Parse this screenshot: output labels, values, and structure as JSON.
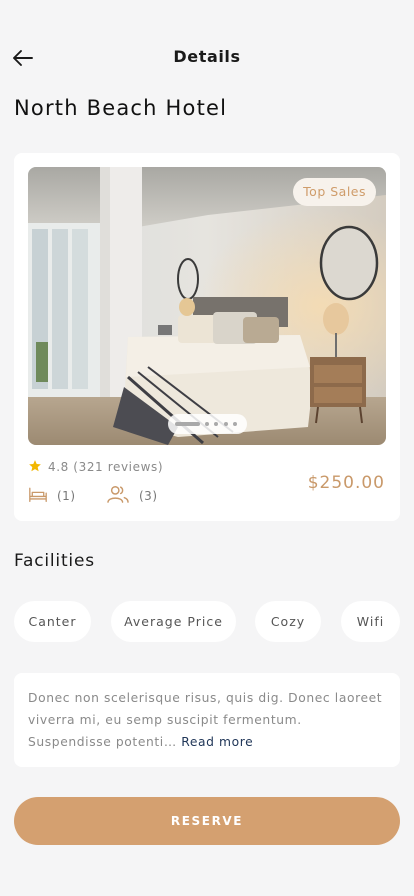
{
  "header": {
    "title": "Details",
    "back_icon": "arrow-left-icon"
  },
  "hotel": {
    "name": "North Beach Hotel",
    "badge": "Top Sales",
    "rating_text": "4.8 (321 reviews)",
    "beds": "(1)",
    "guests": "(3)",
    "price": "$250.00",
    "gallery": {
      "total": 5,
      "current": 1
    }
  },
  "facilities": {
    "title": "Facilities",
    "chips": [
      "Canter",
      "Average Price",
      "Cozy",
      "Wifi"
    ]
  },
  "description": {
    "text": "Donec non scelerisque risus, quis dig. Donec laoreet viverra mi, eu semp suscipit fermentum. Suspendisse potenti…",
    "read_more": "Read more"
  },
  "cta": {
    "label": "RESERVE"
  },
  "colors": {
    "accent": "#d4a070",
    "price": "#c9996a",
    "star": "#f2b701",
    "link": "#1f3557",
    "background": "#f5f5f6"
  }
}
